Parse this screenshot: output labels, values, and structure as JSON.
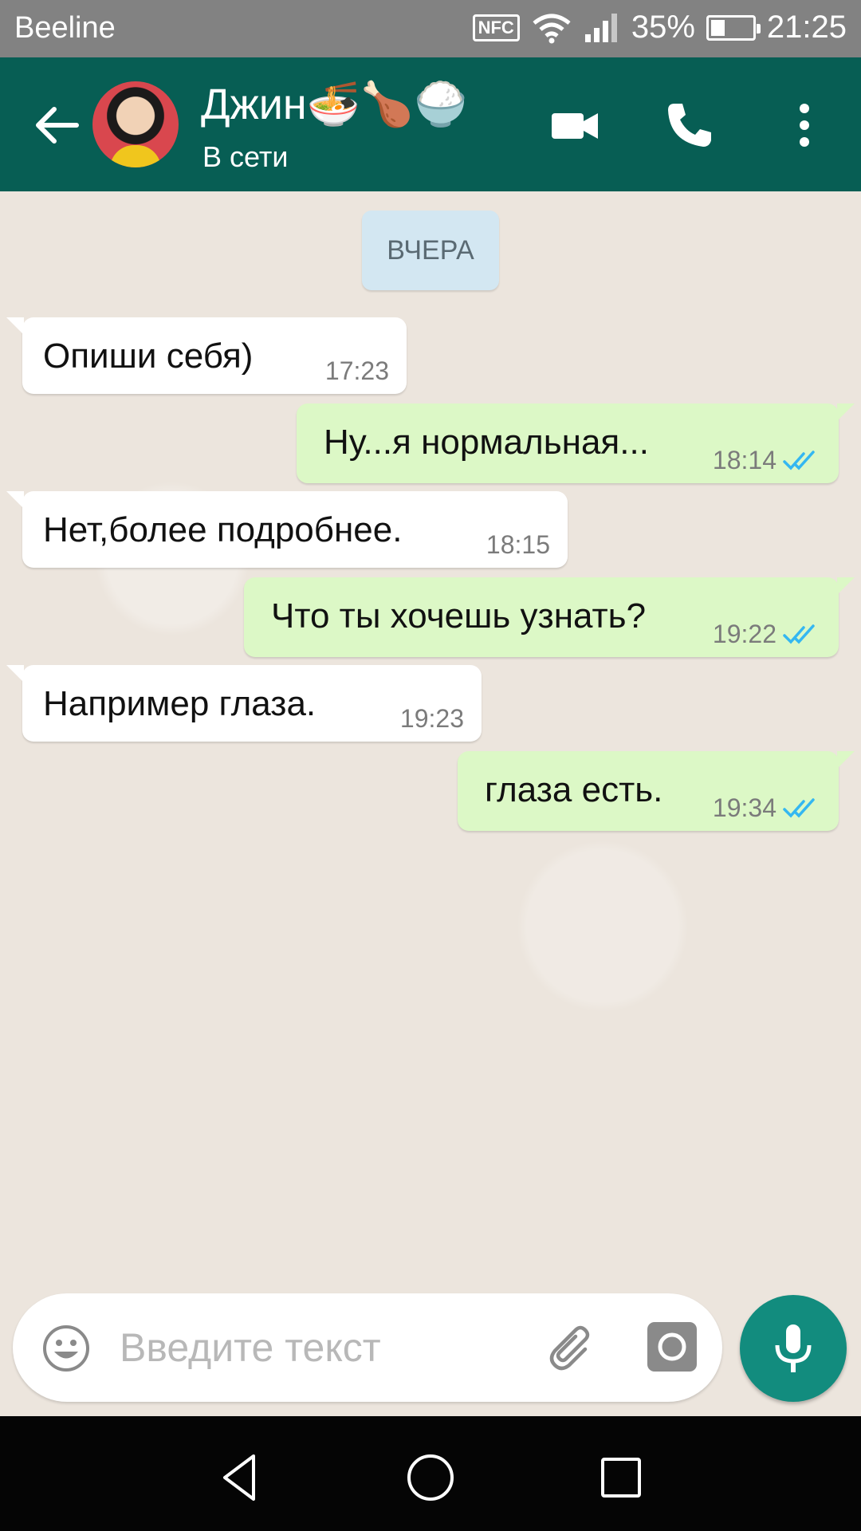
{
  "status_bar": {
    "carrier": "Beeline",
    "nfc": "NFC",
    "battery": "35%",
    "battery_level": 0.35,
    "time": "21:25"
  },
  "header": {
    "contact_name": "Джин🍜🍗🍚",
    "contact_status": "В сети"
  },
  "chat": {
    "date_chip": "ВЧЕРА",
    "messages": [
      {
        "direction": "in",
        "text": "Опиши себя)",
        "time": "17:23"
      },
      {
        "direction": "out",
        "text": "Ну...я нормальная...",
        "time": "18:14",
        "read": true
      },
      {
        "direction": "in",
        "text": "Нет,более подробнее.",
        "time": "18:15"
      },
      {
        "direction": "out",
        "text": "Что ты хочешь узнать?",
        "time": "19:22",
        "read": true
      },
      {
        "direction": "in",
        "text": "Например глаза.",
        "time": "19:23"
      },
      {
        "direction": "out",
        "text": "глаза есть.",
        "time": "19:34",
        "read": true
      }
    ]
  },
  "composer": {
    "placeholder": "Введите текст"
  },
  "colors": {
    "header": "#075e54",
    "incoming": "#ffffff",
    "outgoing": "#dcf8c6",
    "read_ticks": "#34b7f1",
    "mic": "#128c7e"
  },
  "icons": [
    "back-arrow-icon",
    "video-camera-icon",
    "phone-icon",
    "more-vert-icon",
    "emoji-icon",
    "paperclip-icon",
    "camera-icon",
    "mic-icon"
  ]
}
